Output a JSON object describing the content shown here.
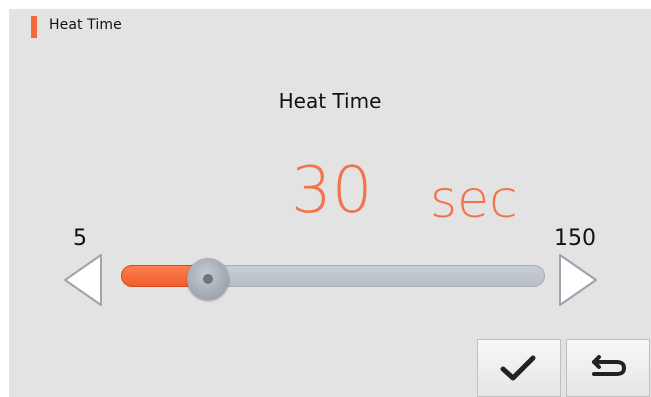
{
  "header": {
    "title": "Heat Time"
  },
  "setting": {
    "label": "Heat Time",
    "value": "30",
    "unit": "sec",
    "min": "5",
    "max": "150",
    "level_fraction": 0.1724
  },
  "colors": {
    "accent": "#f26a3b",
    "value_text": "#f2744a",
    "background": "#e3e3e3"
  },
  "icons": {
    "decrease": "left-arrow-icon",
    "increase": "right-arrow-icon",
    "confirm": "checkmark-icon",
    "back": "return-arrow-icon"
  }
}
